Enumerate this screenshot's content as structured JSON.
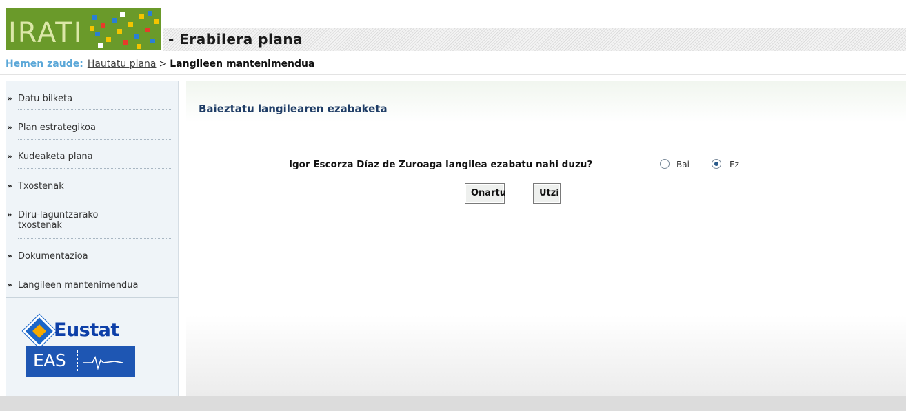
{
  "header": {
    "logo_text": "IRATI",
    "app_title": "- Erabilera plana",
    "colors": {
      "logo_bg": "#6a9a2a",
      "accent": "#5aa7d8"
    }
  },
  "breadcrumb": {
    "prefix": "Hemen zaude:",
    "link": "Hautatu plana",
    "separator": ">",
    "current": "Langileen mantenimendua"
  },
  "sidebar": {
    "items": [
      {
        "label": "Datu bilketa",
        "icon": "double-chevron-icon"
      },
      {
        "label": "Plan estrategikoa",
        "icon": "double-chevron-icon"
      },
      {
        "label": "Kudeaketa plana",
        "icon": "double-chevron-icon"
      },
      {
        "label": "Txostenak",
        "icon": "double-chevron-icon"
      },
      {
        "label": "Diru-laguntzarako",
        "label2": "txostenak",
        "icon": "double-chevron-icon"
      },
      {
        "label": "Dokumentazioa",
        "icon": "double-chevron-icon"
      },
      {
        "label": "Langileen mantenimendua",
        "icon": "double-chevron-icon"
      }
    ],
    "arrow_glyph": "»",
    "logos": {
      "eustat": "Eustat",
      "eas": "EAS"
    }
  },
  "main": {
    "title": "Baieztatu langilearen ezabaketa",
    "question": "Igor Escorza Díaz de Zuroaga langilea ezabatu nahi duzu?",
    "options": [
      {
        "label": "Bai",
        "selected": false
      },
      {
        "label": "Ez",
        "selected": true
      }
    ],
    "buttons": {
      "confirm": "Onartu",
      "cancel": "Utzi"
    }
  }
}
